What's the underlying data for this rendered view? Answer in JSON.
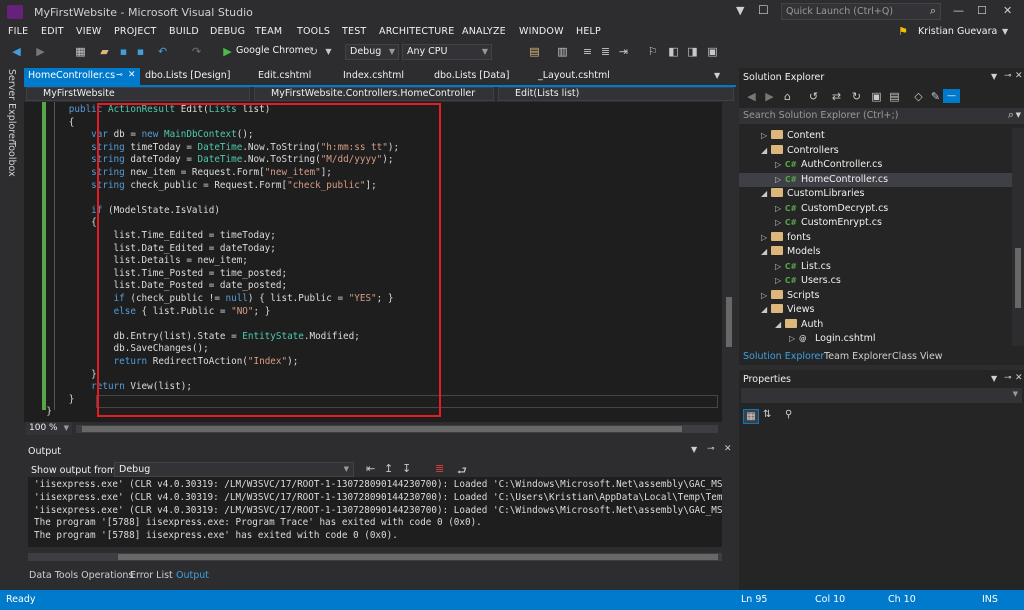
{
  "window": {
    "title": "MyFirstWebsite - Microsoft Visual Studio",
    "quick_launch_placeholder": "Quick Launch (Ctrl+Q)",
    "user_name": "Kristian Guevara"
  },
  "menu": [
    "FILE",
    "EDIT",
    "VIEW",
    "PROJECT",
    "BUILD",
    "DEBUG",
    "TEAM",
    "TOOLS",
    "TEST",
    "ARCHITECTURE",
    "ANALYZE",
    "WINDOW",
    "HELP"
  ],
  "toolbar": {
    "browser": "Google Chrome",
    "config": "Debug",
    "platform": "Any CPU"
  },
  "side_tabs": [
    "Server Explorer",
    "Toolbox"
  ],
  "doc_tabs": [
    "HomeController.cs",
    "dbo.Lists [Design]",
    "Edit.cshtml",
    "Index.cshtml",
    "dbo.Lists [Data]",
    "_Layout.cshtml"
  ],
  "nav": {
    "project": "MyFirstWebsite",
    "class": "MyFirstWebsite.Controllers.HomeController",
    "member": "Edit(Lists list)"
  },
  "code_lines": [
    [
      {
        "t": "        "
      },
      {
        "t": "public",
        "c": "kw"
      },
      {
        "t": " "
      },
      {
        "t": "ActionResult",
        "c": "ty"
      },
      {
        "t": " Edit("
      },
      {
        "t": "Lists",
        "c": "ty"
      },
      {
        "t": " list)"
      }
    ],
    [
      {
        "t": "        {"
      }
    ],
    [
      {
        "t": "            "
      },
      {
        "t": "var",
        "c": "kw"
      },
      {
        "t": " db = "
      },
      {
        "t": "new",
        "c": "kw"
      },
      {
        "t": " "
      },
      {
        "t": "MainDbContext",
        "c": "ty"
      },
      {
        "t": "();"
      }
    ],
    [
      {
        "t": "            "
      },
      {
        "t": "string",
        "c": "kw"
      },
      {
        "t": " timeToday = "
      },
      {
        "t": "DateTime",
        "c": "ty"
      },
      {
        "t": ".Now.ToString("
      },
      {
        "t": "\"h:mm:ss tt\"",
        "c": "st"
      },
      {
        "t": ");"
      }
    ],
    [
      {
        "t": "            "
      },
      {
        "t": "string",
        "c": "kw"
      },
      {
        "t": " dateToday = "
      },
      {
        "t": "DateTime",
        "c": "ty"
      },
      {
        "t": ".Now.ToString("
      },
      {
        "t": "\"M/dd/yyyy\"",
        "c": "st"
      },
      {
        "t": ");"
      }
    ],
    [
      {
        "t": "            "
      },
      {
        "t": "string",
        "c": "kw"
      },
      {
        "t": " new_item = Request.Form["
      },
      {
        "t": "\"new_item\"",
        "c": "st"
      },
      {
        "t": "];"
      }
    ],
    [
      {
        "t": "            "
      },
      {
        "t": "string",
        "c": "kw"
      },
      {
        "t": " check_public = Request.Form["
      },
      {
        "t": "\"check_public\"",
        "c": "st"
      },
      {
        "t": "];"
      }
    ],
    [
      {
        "t": ""
      }
    ],
    [
      {
        "t": "            "
      },
      {
        "t": "if",
        "c": "kw"
      },
      {
        "t": " (ModelState.IsValid)"
      }
    ],
    [
      {
        "t": "            {"
      }
    ],
    [
      {
        "t": "                list.Time_Edited = timeToday;"
      }
    ],
    [
      {
        "t": "                list.Date_Edited = dateToday;"
      }
    ],
    [
      {
        "t": "                list.Details = new_item;"
      }
    ],
    [
      {
        "t": "                list.Time_Posted = time_posted;"
      }
    ],
    [
      {
        "t": "                list.Date_Posted = date_posted;"
      }
    ],
    [
      {
        "t": "                "
      },
      {
        "t": "if",
        "c": "kw"
      },
      {
        "t": " (check_public != "
      },
      {
        "t": "null",
        "c": "kw"
      },
      {
        "t": ") { list.Public = "
      },
      {
        "t": "\"YES\"",
        "c": "st"
      },
      {
        "t": "; }"
      }
    ],
    [
      {
        "t": "                "
      },
      {
        "t": "else",
        "c": "kw"
      },
      {
        "t": " { list.Public = "
      },
      {
        "t": "\"NO\"",
        "c": "st"
      },
      {
        "t": "; }"
      }
    ],
    [
      {
        "t": ""
      }
    ],
    [
      {
        "t": "                db.Entry(list).State = "
      },
      {
        "t": "EntityState",
        "c": "ty"
      },
      {
        "t": ".Modified;"
      }
    ],
    [
      {
        "t": "                db.SaveChanges();"
      }
    ],
    [
      {
        "t": "                "
      },
      {
        "t": "return",
        "c": "kw"
      },
      {
        "t": " RedirectToAction("
      },
      {
        "t": "\"Index\"",
        "c": "st"
      },
      {
        "t": ");"
      }
    ],
    [
      {
        "t": "            }"
      }
    ],
    [
      {
        "t": "            "
      },
      {
        "t": "return",
        "c": "kw"
      },
      {
        "t": " View(list);"
      }
    ],
    [
      {
        "t": "        }"
      }
    ],
    [
      {
        "t": "    }"
      }
    ]
  ],
  "editor_footer": {
    "zoom": "100 %"
  },
  "output": {
    "title": "Output",
    "show_from_label": "Show output from:",
    "source": "Debug",
    "lines": [
      "'iisexpress.exe' (CLR v4.0.30319: /LM/W3SVC/17/ROOT-1-130728090144230700): Loaded 'C:\\Windows\\Microsoft.Net\\assembly\\GAC_MSIL",
      "'iisexpress.exe' (CLR v4.0.30319: /LM/W3SVC/17/ROOT-1-130728090144230700): Loaded 'C:\\Users\\Kristian\\AppData\\Local\\Temp\\Tem",
      "'iisexpress.exe' (CLR v4.0.30319: /LM/W3SVC/17/ROOT-1-130728090144230700): Loaded 'C:\\Windows\\Microsoft.Net\\assembly\\GAC_MSIL",
      "The program '[5788] iisexpress.exe: Program Trace' has exited with code 0 (0x0).",
      "The program '[5788] iisexpress.exe' has exited with code 0 (0x0)."
    ]
  },
  "bottom_tabs": [
    "Data Tools Operations",
    "Error List",
    "Output"
  ],
  "solution_explorer": {
    "title": "Solution Explorer",
    "search_placeholder": "Search Solution Explorer (Ctrl+;)",
    "items": [
      {
        "label": "Content",
        "kind": "folder",
        "depth": 1,
        "open": false
      },
      {
        "label": "Controllers",
        "kind": "folder",
        "depth": 1,
        "open": true
      },
      {
        "label": "AuthController.cs",
        "kind": "cs",
        "depth": 2,
        "open": false
      },
      {
        "label": "HomeController.cs",
        "kind": "cs",
        "depth": 2,
        "open": false,
        "selected": true
      },
      {
        "label": "CustomLibraries",
        "kind": "folder",
        "depth": 1,
        "open": true
      },
      {
        "label": "CustomDecrypt.cs",
        "kind": "cs",
        "depth": 2,
        "open": false
      },
      {
        "label": "CustomEnrypt.cs",
        "kind": "cs",
        "depth": 2,
        "open": false
      },
      {
        "label": "fonts",
        "kind": "folder",
        "depth": 1,
        "open": false
      },
      {
        "label": "Models",
        "kind": "folder",
        "depth": 1,
        "open": true
      },
      {
        "label": "List.cs",
        "kind": "cs",
        "depth": 2,
        "open": false
      },
      {
        "label": "Users.cs",
        "kind": "cs",
        "depth": 2,
        "open": false
      },
      {
        "label": "Scripts",
        "kind": "folder",
        "depth": 1,
        "open": false
      },
      {
        "label": "Views",
        "kind": "folder",
        "depth": 1,
        "open": true
      },
      {
        "label": "Auth",
        "kind": "folder",
        "depth": 2,
        "open": true
      },
      {
        "label": "Login.cshtml",
        "kind": "cshtml",
        "depth": 3,
        "open": false
      }
    ],
    "tabs": [
      "Solution Explorer",
      "Team Explorer",
      "Class View"
    ]
  },
  "properties": {
    "title": "Properties"
  },
  "status": {
    "state": "Ready",
    "ln": "Ln 95",
    "col": "Col 10",
    "ch": "Ch 10",
    "mode": "INS"
  },
  "colors": {
    "accent": "#007acc",
    "highlight_box": "#e51c23"
  }
}
